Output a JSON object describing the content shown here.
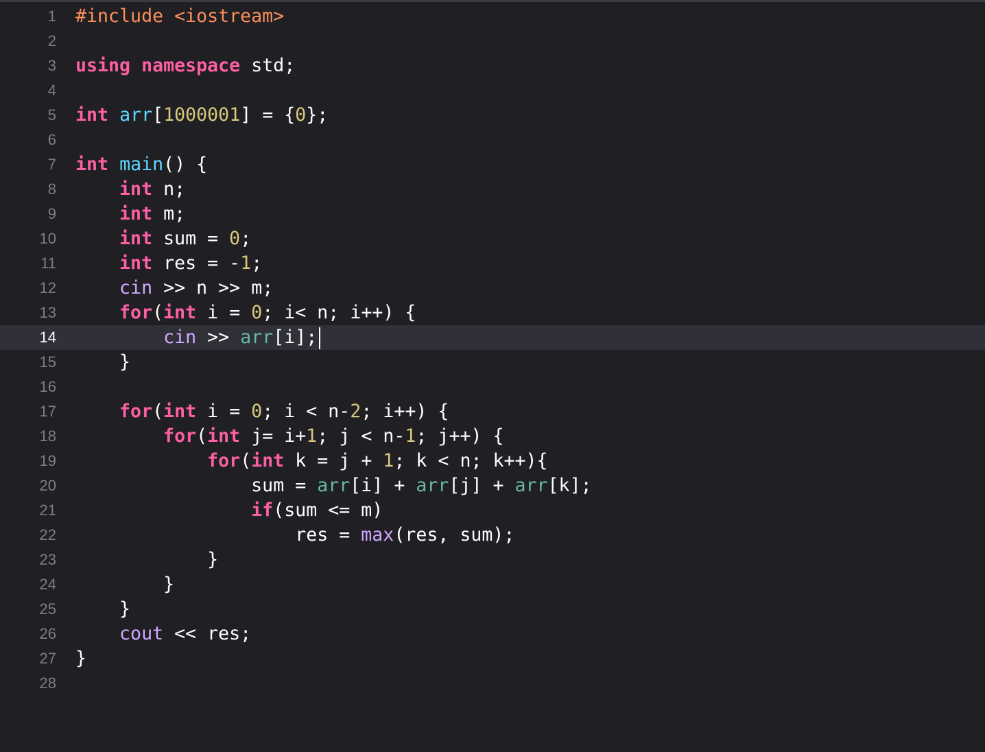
{
  "editor": {
    "language": "cpp",
    "current_line": 14,
    "theme_colors": {
      "background": "#1f1f24",
      "current_line_background": "#2f3038",
      "line_number": "#7d7f86",
      "preprocessor": "#fc8f5a",
      "keyword": "#fc5fa3",
      "number": "#d9c97c",
      "function": "#5dd8ff",
      "identifier": "#67b7a4",
      "library": "#d0a8ff",
      "plain": "#ffffff"
    },
    "lines": [
      {
        "number": "1",
        "tokens": [
          [
            "pre",
            "#include <iostream>"
          ]
        ]
      },
      {
        "number": "2",
        "tokens": []
      },
      {
        "number": "3",
        "tokens": [
          [
            "kw",
            "using"
          ],
          [
            "plain",
            " "
          ],
          [
            "kw",
            "namespace"
          ],
          [
            "plain",
            " std;"
          ]
        ]
      },
      {
        "number": "4",
        "tokens": []
      },
      {
        "number": "5",
        "tokens": [
          [
            "kw",
            "int"
          ],
          [
            "plain",
            " "
          ],
          [
            "fn",
            "arr"
          ],
          [
            "plain",
            "["
          ],
          [
            "num",
            "1000001"
          ],
          [
            "plain",
            "] = {"
          ],
          [
            "num",
            "0"
          ],
          [
            "plain",
            "};"
          ]
        ]
      },
      {
        "number": "6",
        "tokens": []
      },
      {
        "number": "7",
        "tokens": [
          [
            "kw",
            "int"
          ],
          [
            "plain",
            " "
          ],
          [
            "fn",
            "main"
          ],
          [
            "plain",
            "() {"
          ]
        ]
      },
      {
        "number": "8",
        "tokens": [
          [
            "plain",
            "    "
          ],
          [
            "kw",
            "int"
          ],
          [
            "plain",
            " n;"
          ]
        ]
      },
      {
        "number": "9",
        "tokens": [
          [
            "plain",
            "    "
          ],
          [
            "kw",
            "int"
          ],
          [
            "plain",
            " m;"
          ]
        ]
      },
      {
        "number": "10",
        "tokens": [
          [
            "plain",
            "    "
          ],
          [
            "kw",
            "int"
          ],
          [
            "plain",
            " sum = "
          ],
          [
            "num",
            "0"
          ],
          [
            "plain",
            ";"
          ]
        ]
      },
      {
        "number": "11",
        "tokens": [
          [
            "plain",
            "    "
          ],
          [
            "kw",
            "int"
          ],
          [
            "plain",
            " res = -"
          ],
          [
            "num",
            "1"
          ],
          [
            "plain",
            ";"
          ]
        ]
      },
      {
        "number": "12",
        "tokens": [
          [
            "plain",
            "    "
          ],
          [
            "lib",
            "cin"
          ],
          [
            "plain",
            " >> n >> m;"
          ]
        ]
      },
      {
        "number": "13",
        "tokens": [
          [
            "plain",
            "    "
          ],
          [
            "kw",
            "for"
          ],
          [
            "plain",
            "("
          ],
          [
            "kw",
            "int"
          ],
          [
            "plain",
            " i = "
          ],
          [
            "num",
            "0"
          ],
          [
            "plain",
            "; i< n; i++) {"
          ]
        ]
      },
      {
        "number": "14",
        "tokens": [
          [
            "plain",
            "        "
          ],
          [
            "lib",
            "cin"
          ],
          [
            "plain",
            " >> "
          ],
          [
            "id",
            "arr"
          ],
          [
            "plain",
            "[i];"
          ]
        ]
      },
      {
        "number": "15",
        "tokens": [
          [
            "plain",
            "    }"
          ]
        ]
      },
      {
        "number": "16",
        "tokens": []
      },
      {
        "number": "17",
        "tokens": [
          [
            "plain",
            "    "
          ],
          [
            "kw",
            "for"
          ],
          [
            "plain",
            "("
          ],
          [
            "kw",
            "int"
          ],
          [
            "plain",
            " i = "
          ],
          [
            "num",
            "0"
          ],
          [
            "plain",
            "; i < n-"
          ],
          [
            "num",
            "2"
          ],
          [
            "plain",
            "; i++) {"
          ]
        ]
      },
      {
        "number": "18",
        "tokens": [
          [
            "plain",
            "        "
          ],
          [
            "kw",
            "for"
          ],
          [
            "plain",
            "("
          ],
          [
            "kw",
            "int"
          ],
          [
            "plain",
            " j= i+"
          ],
          [
            "num",
            "1"
          ],
          [
            "plain",
            "; j < n-"
          ],
          [
            "num",
            "1"
          ],
          [
            "plain",
            "; j++) {"
          ]
        ]
      },
      {
        "number": "19",
        "tokens": [
          [
            "plain",
            "            "
          ],
          [
            "kw",
            "for"
          ],
          [
            "plain",
            "("
          ],
          [
            "kw",
            "int"
          ],
          [
            "plain",
            " k = j + "
          ],
          [
            "num",
            "1"
          ],
          [
            "plain",
            "; k < n; k++){"
          ]
        ]
      },
      {
        "number": "20",
        "tokens": [
          [
            "plain",
            "                sum = "
          ],
          [
            "id",
            "arr"
          ],
          [
            "plain",
            "[i] + "
          ],
          [
            "id",
            "arr"
          ],
          [
            "plain",
            "[j] + "
          ],
          [
            "id",
            "arr"
          ],
          [
            "plain",
            "[k];"
          ]
        ]
      },
      {
        "number": "21",
        "tokens": [
          [
            "plain",
            "                "
          ],
          [
            "kw",
            "if"
          ],
          [
            "plain",
            "(sum <= m)"
          ]
        ]
      },
      {
        "number": "22",
        "tokens": [
          [
            "plain",
            "                    res = "
          ],
          [
            "lib",
            "max"
          ],
          [
            "plain",
            "(res, sum);"
          ]
        ]
      },
      {
        "number": "23",
        "tokens": [
          [
            "plain",
            "            }"
          ]
        ]
      },
      {
        "number": "24",
        "tokens": [
          [
            "plain",
            "        }"
          ]
        ]
      },
      {
        "number": "25",
        "tokens": [
          [
            "plain",
            "    }"
          ]
        ]
      },
      {
        "number": "26",
        "tokens": [
          [
            "plain",
            "    "
          ],
          [
            "lib",
            "cout"
          ],
          [
            "plain",
            " << res;"
          ]
        ]
      },
      {
        "number": "27",
        "tokens": [
          [
            "plain",
            "}"
          ]
        ]
      },
      {
        "number": "28",
        "tokens": []
      }
    ]
  }
}
